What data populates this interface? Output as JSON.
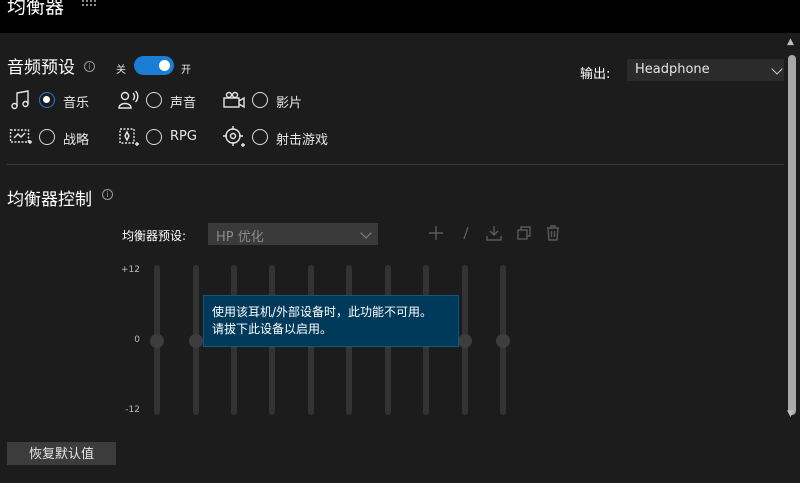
{
  "window": {
    "title": "均衡器"
  },
  "audio_preset": {
    "title": "音频预设",
    "toggle_off": "关",
    "toggle_on": "开",
    "output_label": "输出:",
    "output_value": "Headphone",
    "presets": [
      {
        "label": "音乐",
        "icon": "music-note-icon",
        "checked": true
      },
      {
        "label": "声音",
        "icon": "voice-icon",
        "checked": false
      },
      {
        "label": "影片",
        "icon": "video-camera-icon",
        "checked": false
      },
      {
        "label": "战略",
        "icon": "strategy-icon",
        "checked": false
      },
      {
        "label": "RPG",
        "icon": "rpg-icon",
        "checked": false
      },
      {
        "label": "射击游戏",
        "icon": "crosshair-icon",
        "checked": false
      }
    ]
  },
  "eq_control": {
    "title": "均衡器控制",
    "preset_label": "均衡器预设:",
    "preset_value": "HP 优化",
    "scale_top": "+12",
    "scale_mid": "0",
    "scale_bottom": "-12",
    "band_levels": [
      0,
      0,
      0,
      0,
      0,
      0,
      0,
      0,
      0,
      0
    ],
    "tooltip_line1": "使用该耳机/外部设备时，此功能不可用。",
    "tooltip_line2": "请拔下此设备以启用。",
    "reset_label": "恢复默认值"
  },
  "colors": {
    "accent": "#1a7ed6",
    "tooltip_bg": "#003a5a"
  }
}
